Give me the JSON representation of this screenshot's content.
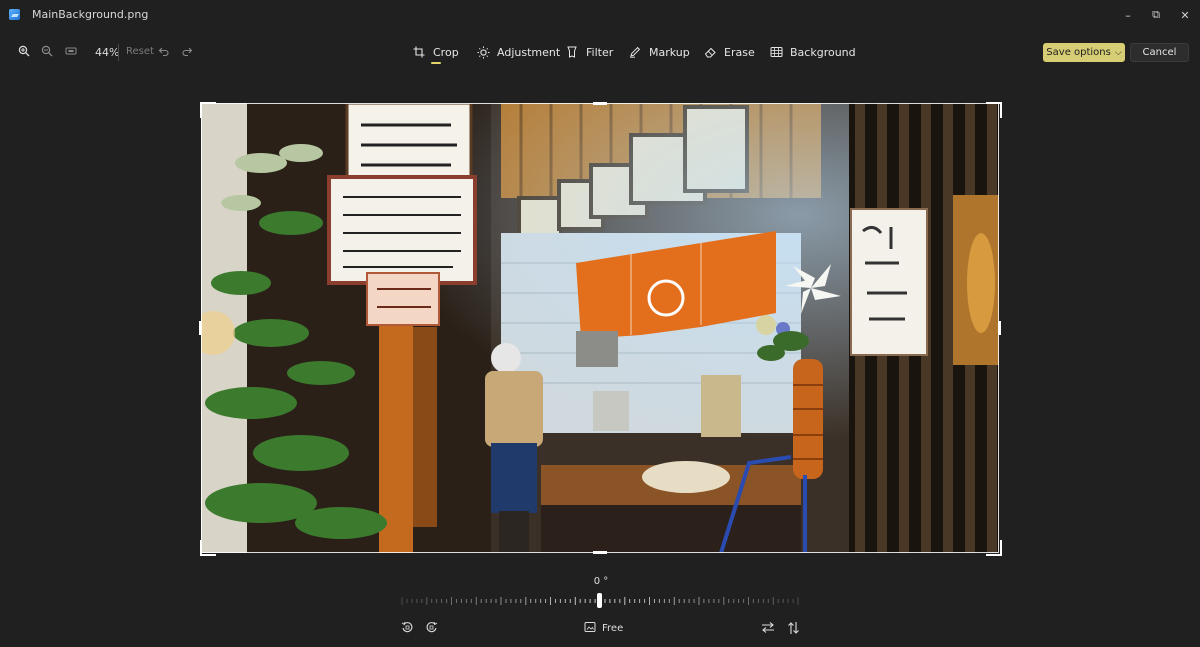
{
  "window": {
    "title": "MainBackground.png",
    "controls": {
      "minimize": "–",
      "restore": "⧉",
      "close": "✕"
    }
  },
  "left_tools": {
    "zoom_in_icon": "zoom-in-icon",
    "zoom_out_icon": "zoom-out-icon",
    "fit_icon": "fit-to-window-icon",
    "zoom_level": "44%",
    "reset_label": "Reset",
    "undo_icon": "undo-icon",
    "redo_icon": "redo-icon"
  },
  "tabs": [
    {
      "label": "Crop",
      "icon": "crop-icon",
      "selected": true
    },
    {
      "label": "Adjustment",
      "icon": "brightness-icon",
      "selected": false
    },
    {
      "label": "Filter",
      "icon": "filter-icon",
      "selected": false
    },
    {
      "label": "Markup",
      "icon": "pen-icon",
      "selected": false
    },
    {
      "label": "Erase",
      "icon": "eraser-icon",
      "selected": false
    },
    {
      "label": "Background",
      "icon": "background-icon",
      "selected": false
    }
  ],
  "actions": {
    "save_label": "Save options",
    "save_chevron": "⌵",
    "cancel_label": "Cancel"
  },
  "straighten": {
    "angle": "0 °",
    "value": 0
  },
  "bottom": {
    "rotate_left_icon": "rotate-left-icon",
    "rotate_right_icon": "rotate-right-icon",
    "aspect_label": "Free",
    "flip_horizontal_icon": "flip-horizontal-icon",
    "flip_vertical_icon": "flip-vertical-icon"
  },
  "colors": {
    "background": "#202020",
    "accent": "#d6cd74",
    "tab_indicator": "#e4d56a"
  }
}
